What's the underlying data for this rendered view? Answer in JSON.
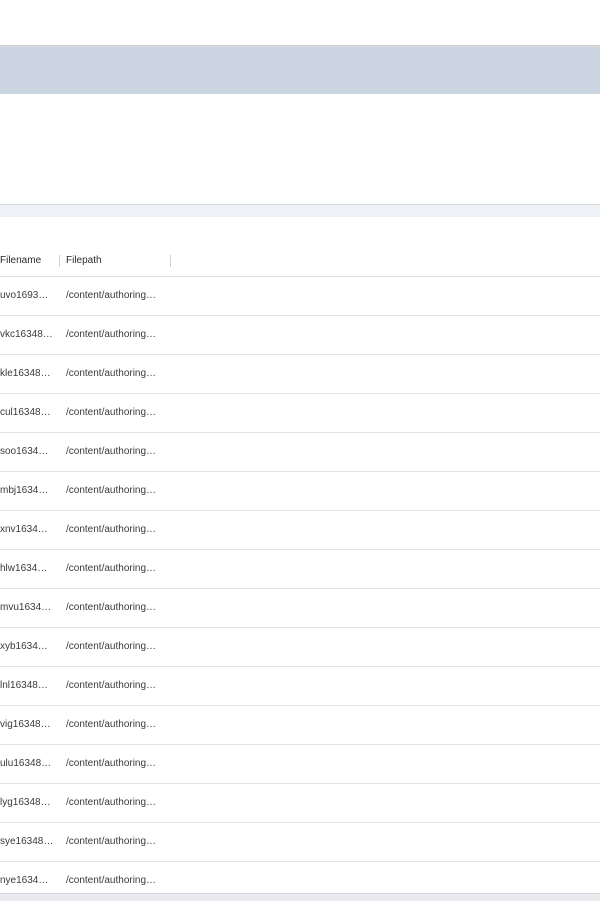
{
  "table": {
    "columns": {
      "filename": "Filename",
      "filepath": "Filepath"
    },
    "rows": [
      {
        "filename": "uvo1693…",
        "filepath": "/content/authoring…"
      },
      {
        "filename": "vkc16348…",
        "filepath": "/content/authoring…"
      },
      {
        "filename": "kle16348…",
        "filepath": "/content/authoring…"
      },
      {
        "filename": "cul16348…",
        "filepath": "/content/authoring…"
      },
      {
        "filename": "soo1634…",
        "filepath": "/content/authoring…"
      },
      {
        "filename": "mbj1634…",
        "filepath": "/content/authoring…"
      },
      {
        "filename": "xnv1634…",
        "filepath": "/content/authoring…"
      },
      {
        "filename": "hlw1634…",
        "filepath": "/content/authoring…"
      },
      {
        "filename": "mvu1634…",
        "filepath": "/content/authoring…"
      },
      {
        "filename": "xyb1634…",
        "filepath": "/content/authoring…"
      },
      {
        "filename": "lnl16348…",
        "filepath": "/content/authoring…"
      },
      {
        "filename": "vig16348…",
        "filepath": "/content/authoring…"
      },
      {
        "filename": "ulu16348…",
        "filepath": "/content/authoring…"
      },
      {
        "filename": "lyg16348…",
        "filepath": "/content/authoring…"
      },
      {
        "filename": "sye16348…",
        "filepath": "/content/authoring…"
      },
      {
        "filename": "nye1634…",
        "filepath": "/content/authoring…"
      }
    ]
  },
  "colors": {
    "toolbar_band": "#cbd5e1",
    "row_border": "#e3e3e3"
  }
}
